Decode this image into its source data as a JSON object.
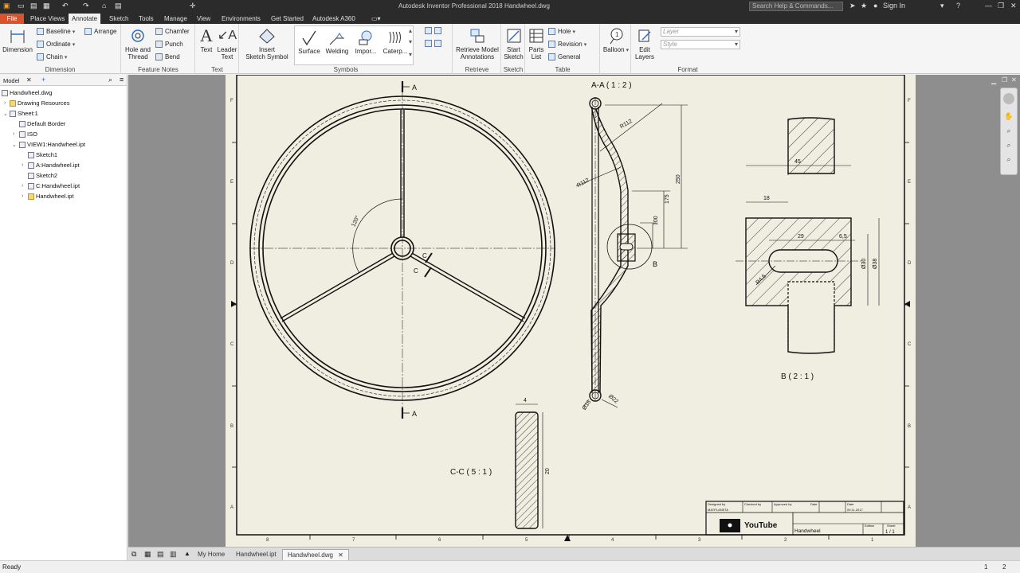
{
  "app": {
    "title": "Autodesk Inventor Professional 2018    Handwheel.dwg",
    "search_placeholder": "Search Help & Commands...",
    "sign_in": "Sign In"
  },
  "menu_tabs": [
    "File",
    "Place Views",
    "Annotate",
    "Sketch",
    "Tools",
    "Manage",
    "View",
    "Environments",
    "Get Started",
    "Autodesk A360"
  ],
  "active_tab": "Annotate",
  "ribbon": {
    "dimension": {
      "title": "Dimension",
      "big": "Dimension",
      "baseline": "Baseline",
      "ordinate": "Ordinate",
      "chain": "Chain",
      "arrange": "Arrange"
    },
    "feature_notes": {
      "title": "Feature Notes",
      "hole_and_thread": [
        "Hole and",
        "Thread"
      ],
      "chamfer": "Chamfer",
      "punch": "Punch",
      "bend": "Bend"
    },
    "text": {
      "title": "Text",
      "text": "Text",
      "leader_text": [
        "Leader",
        "Text"
      ]
    },
    "symbols": {
      "title": "Symbols",
      "insert_sketch_symbol": [
        "Insert",
        "Sketch Symbol"
      ],
      "surface": "Surface",
      "welding": "Welding",
      "import": "Impor...",
      "caterpillar": "Caterp..."
    },
    "retrieve": {
      "title": "Retrieve",
      "label": [
        "Retrieve Model",
        "Annotations"
      ]
    },
    "sketch": {
      "title": "Sketch",
      "label": [
        "Start",
        "Sketch"
      ]
    },
    "table": {
      "title": "Table",
      "parts_list": [
        "Parts",
        "List"
      ],
      "hole": "Hole",
      "revision": "Revision",
      "general": "General"
    },
    "balloon": "Balloon",
    "format": {
      "title": "Format",
      "edit_layers": [
        "Edit",
        "Layers"
      ],
      "layer_placeholder": "Layer",
      "style_placeholder": "Style"
    }
  },
  "browser": {
    "header": "Model",
    "items": [
      {
        "label": "Handwheel.dwg",
        "level": 0
      },
      {
        "label": "Drawing Resources",
        "level": 1
      },
      {
        "label": "Sheet:1",
        "level": 1
      },
      {
        "label": "Default Border",
        "level": 2
      },
      {
        "label": "ISO",
        "level": 2
      },
      {
        "label": "VIEW1:Handwheel.ipt",
        "level": 2
      },
      {
        "label": "Sketch1",
        "level": 3
      },
      {
        "label": "A:Handwheel.ipt",
        "level": 3
      },
      {
        "label": "Sketch2",
        "level": 3
      },
      {
        "label": "C:Handwheel.ipt",
        "level": 3
      },
      {
        "label": "Handwheel.ipt",
        "level": 3
      }
    ]
  },
  "drawing": {
    "section_a_marker": "A",
    "section_c_marker": "C",
    "angle_dim": "120°",
    "view_aa_label": "A-A ( 1 : 2 )",
    "view_aa_dims": {
      "r1": "R112",
      "r2": "R112",
      "d250": "250",
      "d175": "175",
      "d100": "100",
      "d16": "Ø16",
      "d22": "Ø22",
      "detail": "B"
    },
    "view_b_label": "B ( 2 : 1 )",
    "view_b_dims": {
      "d45": "45",
      "d18": "18",
      "d29": "29",
      "d65": "6,5",
      "d30": "Ø30",
      "d38": "Ø38",
      "r45": "R4,5"
    },
    "view_cc_label": "C-C ( 5 : 1 )",
    "view_cc_dims": {
      "d4": "4",
      "d20": "20"
    },
    "zone_cols": [
      "8",
      "7",
      "6",
      "5",
      "4",
      "3",
      "2",
      "1"
    ],
    "zone_rows": [
      "F",
      "E",
      "D",
      "C",
      "B",
      "A"
    ],
    "title_block": {
      "designed_by_h": "Designed by",
      "designed_by": "MATPLANETA",
      "checked_by_h": "Checked by",
      "approved_by_h": "Approved by",
      "date_h": "Date",
      "date_h2": "Date",
      "date": "09.11.2017",
      "logo_text": "YouTube",
      "part_name": "Handwheel",
      "edition_h": "Edition",
      "sheet_h": "Sheet",
      "sheet": "1 / 1"
    }
  },
  "doc_tabs": [
    "My Home",
    "Handwheel.ipt",
    "Handwheel.dwg"
  ],
  "active_doc": "Handwheel.dwg",
  "status": {
    "left": "Ready",
    "num1": "1",
    "num2": "2"
  }
}
